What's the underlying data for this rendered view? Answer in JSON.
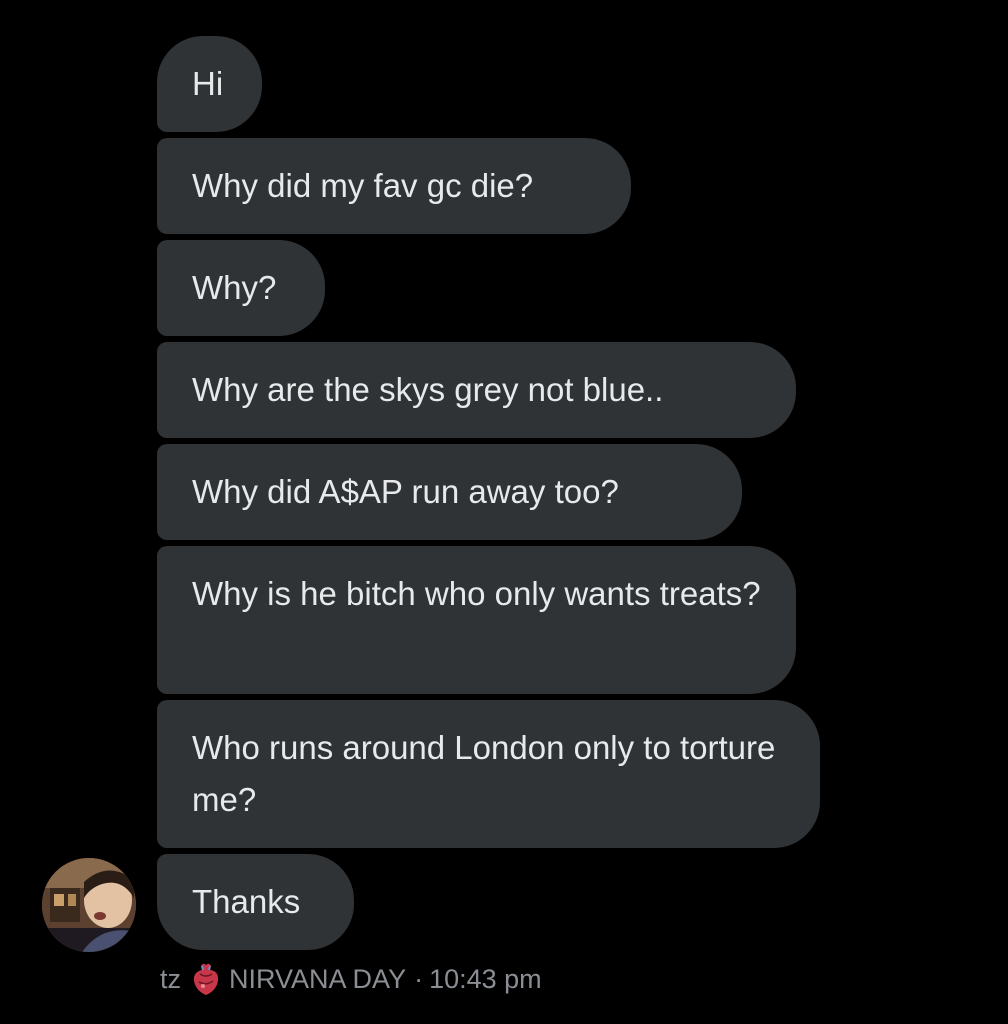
{
  "conversation": {
    "messages": [
      {
        "text": "Hi"
      },
      {
        "text": "Why did my fav gc die?"
      },
      {
        "text": "Why?"
      },
      {
        "text": "Why are the skys grey not blue.."
      },
      {
        "text": "Why did A$AP run away too?"
      },
      {
        "text": "Why is he bitch who only wants treats?"
      },
      {
        "text": "Who runs around London only to torture me?"
      },
      {
        "text": "Thanks"
      }
    ],
    "sender": {
      "name_prefix": "tz",
      "name_suffix": "NIRVANA DAY",
      "emoji_icon": "anatomical-heart-icon"
    },
    "separator": "·",
    "timestamp": "10:43 pm"
  },
  "colors": {
    "background": "#000000",
    "bubble": "#2f3336",
    "text": "#e7e9ea",
    "meta_text": "#8b8f94"
  }
}
